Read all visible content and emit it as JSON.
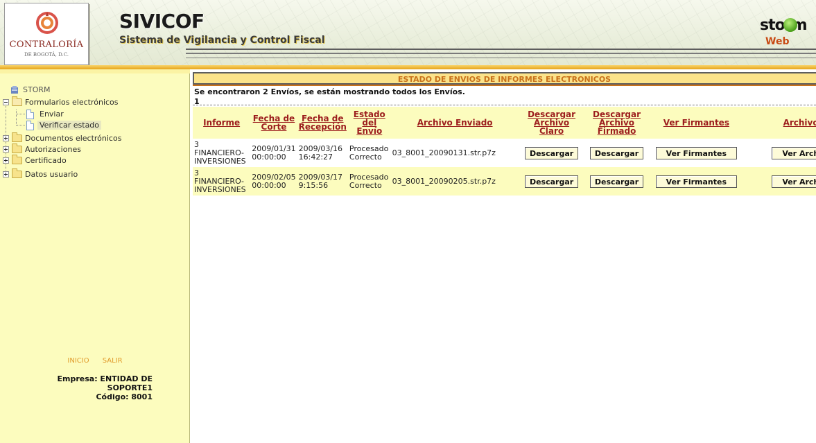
{
  "header": {
    "org_name": "CONTRALORÍA",
    "org_sub": "DE BOGOTÁ, D.C.",
    "app_name": "SIVICOF",
    "app_full_name": "Sistema de Vigilancia y Control Fiscal",
    "vendor_name": "storm",
    "vendor_sub": "Web"
  },
  "sidebar": {
    "root": "STORM",
    "items": [
      {
        "label": "Formularios electrónicos",
        "icon": "folder-open-icon",
        "expanded": true
      },
      {
        "label": "Enviar",
        "icon": "page-icon"
      },
      {
        "label": "Verificar estado",
        "icon": "page-icon",
        "selected": true
      },
      {
        "label": "Documentos electrónicos",
        "icon": "folder-icon",
        "expanded": false
      },
      {
        "label": "Autorizaciones",
        "icon": "folder-icon",
        "expanded": false
      },
      {
        "label": "Certificado",
        "icon": "folder-icon",
        "expanded": false
      },
      {
        "label": "Datos usuario",
        "icon": "folder-icon",
        "expanded": false
      }
    ],
    "links": {
      "inicio": "INICIO",
      "salir": "SALIR"
    },
    "empresa_line1": "Empresa: ENTIDAD DE",
    "empresa_line2": "SOPORTE1",
    "codigo": "Código: 8001"
  },
  "main": {
    "title": "ESTADO DE ENVIOS DE INFORMES ELECTRONICOS",
    "status": "Se encontraron 2 Envíos, se están mostrando todos los Envíos.",
    "page": "1",
    "columns": {
      "informe": "Informe",
      "fecha_corte_1": "Fecha de",
      "fecha_corte_2": "Corte",
      "fecha_recepcion_1": "Fecha de",
      "fecha_recepcion_2": "Recepción",
      "estado_1": "Estado",
      "estado_2": "del",
      "estado_3": "Envío",
      "archivo_enviado": "Archivo Enviado",
      "descargar_claro_1": "Descargar",
      "descargar_claro_2": "Archivo Claro",
      "descargar_firmado_1": "Descargar",
      "descargar_firmado_2": "Archivo",
      "descargar_firmado_3": "Firmado",
      "ver_firmantes": "Ver Firmantes",
      "archivo": "Archivo"
    },
    "rows": [
      {
        "informe_1": "3",
        "informe_2": "FINANCIERO-",
        "informe_3": "INVERSIONES",
        "fecha_corte_1": "2009/01/31",
        "fecha_corte_2": "00:00:00",
        "fecha_recepcion_1": "2009/03/16",
        "fecha_recepcion_2": "16:42:27",
        "estado_1": "Procesado",
        "estado_2": "Correcto",
        "archivo": "03_8001_20090131.str.p7z",
        "btn_claro": "Descargar",
        "btn_firmado": "Descargar",
        "btn_firmantes": "Ver Firmantes",
        "btn_archivo": "Ver Archi"
      },
      {
        "informe_1": "3",
        "informe_2": "FINANCIERO-",
        "informe_3": "INVERSIONES",
        "fecha_corte_1": "2009/02/05",
        "fecha_corte_2": "00:00:00",
        "fecha_recepcion_1": "2009/03/17",
        "fecha_recepcion_2": "9:15:56",
        "estado_1": "Procesado",
        "estado_2": "Correcto",
        "archivo": "03_8001_20090205.str.p7z",
        "btn_claro": "Descargar",
        "btn_firmado": "Descargar",
        "btn_firmantes": "Ver Firmantes",
        "btn_archivo": "Ver Archi"
      }
    ]
  },
  "colors": {
    "sidebar_bg": "#fcfcbe",
    "header_accent": "#e7a41a",
    "title_text": "#c8711a",
    "column_header_text": "#9c1d1d"
  }
}
